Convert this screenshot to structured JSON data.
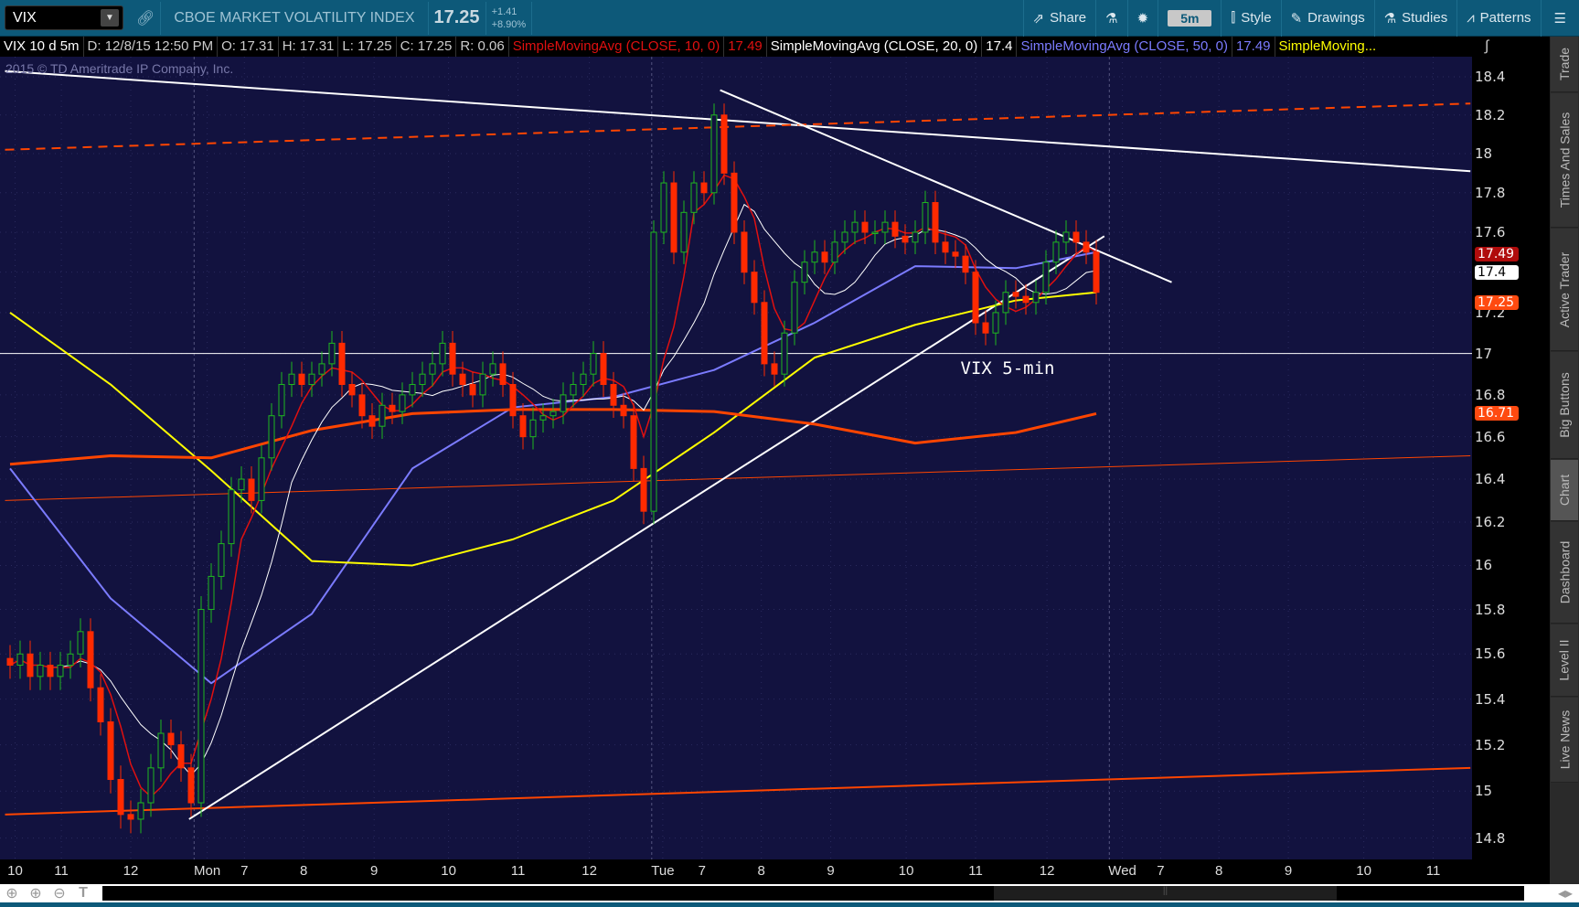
{
  "toolbar": {
    "symbol": "VIX",
    "description": "CBOE MARKET VOLATILITY INDEX",
    "last": "17.25",
    "change": "+1.41",
    "change_pct": "+8.90%",
    "share": "Share",
    "timeframe": "5m",
    "style": "Style",
    "drawings": "Drawings",
    "studies": "Studies",
    "patterns": "Patterns"
  },
  "infobar": {
    "period": "VIX 10 d 5m",
    "date": "D: 12/8/15 12:50 PM",
    "open": "O: 17.31",
    "high": "H: 17.31",
    "low": "L: 17.25",
    "close": "C: 17.25",
    "range": "R: 0.06",
    "studies": [
      {
        "name": "SimpleMovingAvg (CLOSE, 10, 0)",
        "value": "17.49",
        "color": "#e01010"
      },
      {
        "name": "SimpleMovingAvg (CLOSE, 20, 0)",
        "value": "17.4",
        "color": "#ffffff"
      },
      {
        "name": "SimpleMovingAvg (CLOSE, 50, 0)",
        "value": "17.49",
        "color": "#7b7bff"
      },
      {
        "name": "SimpleMoving...",
        "value": "",
        "color": "#ffff00"
      }
    ]
  },
  "copyright": "2015 © TD Ameritrade IP Company, Inc.",
  "right_tabs": [
    "Trade",
    "Times And Sales",
    "Active Trader",
    "Big Buttons",
    "Chart",
    "Dashboard",
    "Level II",
    "Live News"
  ],
  "active_tab": "Chart",
  "chart_data": {
    "type": "candlestick",
    "title": "VIX 5-min",
    "scale": "log",
    "ylim": [
      14.7,
      18.5
    ],
    "yticks": [
      "18.4",
      "18.2",
      "18",
      "17.8",
      "17.6",
      "17.4",
      "17.2",
      "17",
      "16.8",
      "16.6",
      "16.4",
      "16.2",
      "16",
      "15.8",
      "15.6",
      "15.4",
      "15.2",
      "15",
      "14.8"
    ],
    "xticks": [
      {
        "label": "10",
        "idx": 0.5
      },
      {
        "label": "11",
        "idx": 5.1
      },
      {
        "label": "12",
        "idx": 12
      },
      {
        "label": "Mon",
        "idx": 19.6
      },
      {
        "label": "7",
        "idx": 23.3
      },
      {
        "label": "8",
        "idx": 29.2
      },
      {
        "label": "9",
        "idx": 36.2
      },
      {
        "label": "10",
        "idx": 43.6
      },
      {
        "label": "11",
        "idx": 50.5
      },
      {
        "label": "12",
        "idx": 57.6
      },
      {
        "label": "Tue",
        "idx": 64.9
      },
      {
        "label": "7",
        "idx": 68.8
      },
      {
        "label": "8",
        "idx": 74.7
      },
      {
        "label": "9",
        "idx": 81.6
      },
      {
        "label": "10",
        "idx": 89.1
      },
      {
        "label": "11",
        "idx": 96
      },
      {
        "label": "12",
        "idx": 103.1
      },
      {
        "label": "Wed",
        "idx": 110.6
      },
      {
        "label": "7",
        "idx": 114.4
      },
      {
        "label": "8",
        "idx": 120.2
      },
      {
        "label": "9",
        "idx": 127.1
      },
      {
        "label": "10",
        "idx": 134.6
      },
      {
        "label": "11",
        "idx": 141.5
      }
    ],
    "day_breaks": [
      18.3,
      63.8,
      109.3
    ],
    "closes": [
      15.55,
      15.6,
      15.5,
      15.55,
      15.5,
      15.55,
      15.6,
      15.7,
      15.45,
      15.3,
      15.05,
      14.9,
      14.88,
      14.95,
      15.1,
      15.25,
      15.2,
      15.1,
      14.95,
      15.8,
      15.95,
      16.1,
      16.35,
      16.4,
      16.3,
      16.5,
      16.7,
      16.85,
      16.9,
      16.85,
      16.9,
      16.95,
      17.05,
      16.85,
      16.8,
      16.7,
      16.65,
      16.75,
      16.72,
      16.8,
      16.85,
      16.9,
      16.95,
      17.05,
      16.9,
      16.85,
      16.8,
      16.9,
      16.95,
      16.85,
      16.7,
      16.6,
      16.68,
      16.7,
      16.72,
      16.8,
      16.85,
      16.9,
      17.0,
      16.85,
      16.75,
      16.7,
      16.45,
      16.25,
      17.6,
      17.85,
      17.5,
      17.7,
      17.85,
      17.8,
      18.2,
      17.9,
      17.6,
      17.4,
      17.25,
      16.95,
      16.9,
      17.1,
      17.35,
      17.45,
      17.5,
      17.45,
      17.55,
      17.6,
      17.65,
      17.6,
      17.6,
      17.65,
      17.58,
      17.55,
      17.6,
      17.75,
      17.55,
      17.5,
      17.48,
      17.4,
      17.15,
      17.1,
      17.2,
      17.3,
      17.28,
      17.25,
      17.3,
      17.45,
      17.55,
      17.6,
      17.55,
      17.5,
      17.3
    ],
    "sma_sample_idx": [
      0,
      10,
      20,
      30,
      40,
      50,
      60,
      70,
      80,
      90,
      100,
      108
    ],
    "series": [
      {
        "name": "SMA 50",
        "color": "#7b7bff",
        "values": [
          16.45,
          15.85,
          15.47,
          15.78,
          16.45,
          16.74,
          16.79,
          16.92,
          17.15,
          17.43,
          17.42,
          17.5
        ]
      },
      {
        "name": "SMA yellow",
        "color": "#ffff00",
        "values": [
          17.2,
          16.85,
          16.44,
          16.02,
          16.0,
          16.12,
          16.3,
          16.62,
          16.98,
          17.14,
          17.26,
          17.3
        ]
      },
      {
        "name": "SMA orange",
        "color": "#ff4500",
        "values": [
          16.47,
          16.51,
          16.5,
          16.63,
          16.71,
          16.73,
          16.73,
          16.72,
          16.66,
          16.57,
          16.62,
          16.71
        ]
      }
    ],
    "drawings": [
      {
        "name": "resistance-line",
        "color": "#ffffff",
        "dash": false,
        "width": 2,
        "from": [
          -0.5,
          18.43
        ],
        "to": [
          145.2,
          17.91
        ]
      },
      {
        "name": "channel-top",
        "color": "#ff4500",
        "dash": true,
        "width": 2,
        "from": [
          -0.5,
          18.02
        ],
        "to": [
          145.2,
          18.26
        ]
      },
      {
        "name": "level-17",
        "color": "#ffffff",
        "dash": false,
        "width": 1,
        "from": [
          -1,
          17.0
        ],
        "to": [
          146,
          17.0
        ]
      },
      {
        "name": "channel-mid",
        "color": "#ff4500",
        "dash": false,
        "width": 1,
        "from": [
          -0.5,
          16.3
        ],
        "to": [
          145.2,
          16.51
        ]
      },
      {
        "name": "channel-bottom",
        "color": "#ff4500",
        "dash": false,
        "width": 2,
        "from": [
          -0.5,
          14.9
        ],
        "to": [
          145.2,
          15.1
        ]
      },
      {
        "name": "support-trendline",
        "color": "#ffffff",
        "dash": false,
        "width": 2,
        "from": [
          17.8,
          14.88
        ],
        "to": [
          108.8,
          17.58
        ]
      },
      {
        "name": "falling-trendline",
        "color": "#ffffff",
        "dash": false,
        "width": 2,
        "from": [
          70.6,
          18.33
        ],
        "to": [
          115.5,
          17.35
        ]
      }
    ],
    "label_pos": {
      "idx": 94.5,
      "price": 16.9
    },
    "price_tags": [
      {
        "value": "17.49",
        "price": 17.49,
        "bg": "#b00c0c",
        "fg": "#fff"
      },
      {
        "value": "17.4",
        "price": 17.4,
        "bg": "#ffffff",
        "fg": "#000"
      },
      {
        "value": "17.25",
        "price": 17.25,
        "bg": "#ff4a10",
        "fg": "#fff"
      },
      {
        "value": "16.71",
        "price": 16.71,
        "bg": "#ff4a10",
        "fg": "#fff"
      }
    ]
  }
}
